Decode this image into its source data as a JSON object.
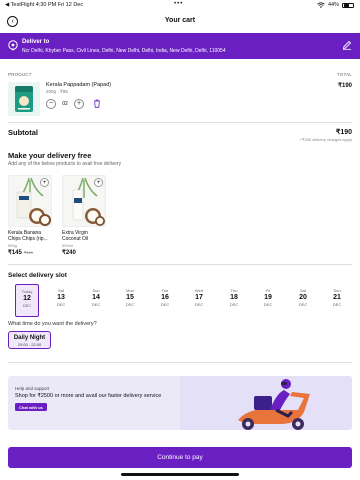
{
  "status_bar": {
    "left": "◀ TestFlight  4:30 PM  Fri 12 Dec",
    "center": "•••",
    "battery": "44%"
  },
  "header": {
    "title": "Your cart"
  },
  "delivery": {
    "label": "Deliver to",
    "address": "Ncr Delhi, Khyber Pass, Civil Lines, Delhi, New Delhi, Delhi, India, New Delhi, Delhi, 110054"
  },
  "cart": {
    "col_product": "PRODUCT",
    "col_total": "TOTAL",
    "item": {
      "name": "Kerala Pappadam (Papad)",
      "meta": "200g · ₹95",
      "quantity": "02",
      "total": "₹190"
    }
  },
  "subtotal": {
    "label": "Subtotal",
    "value": "₹190",
    "note": "+₹250 delivery charges apply"
  },
  "free_delivery": {
    "title": "Make your delivery free",
    "subtitle": "Add any of the below products to avail free delivery",
    "products": [
      {
        "name": "Kerala Banana Chips Chips (rip...",
        "meta": "500g",
        "price": "₹145",
        "mrp": "₹169"
      },
      {
        "name": "Extra Virgin Coconut Oil",
        "meta": "500ml",
        "price": "₹240",
        "mrp": ""
      }
    ]
  },
  "delivery_slot": {
    "title": "Select delivery slot",
    "dates": [
      {
        "weekday": "Today",
        "day": "12",
        "month": "DEC"
      },
      {
        "weekday": "Sat",
        "day": "13",
        "month": "DEC"
      },
      {
        "weekday": "Sun",
        "day": "14",
        "month": "DEC"
      },
      {
        "weekday": "Mon",
        "day": "15",
        "month": "DEC"
      },
      {
        "weekday": "Tue",
        "day": "16",
        "month": "DEC"
      },
      {
        "weekday": "Wed",
        "day": "17",
        "month": "DEC"
      },
      {
        "weekday": "Thu",
        "day": "18",
        "month": "DEC"
      },
      {
        "weekday": "Fri",
        "day": "19",
        "month": "DEC"
      },
      {
        "weekday": "Sat",
        "day": "20",
        "month": "DEC"
      },
      {
        "weekday": "Sun",
        "day": "21",
        "month": "DEC"
      }
    ],
    "time_question": "What time do you want the delivery?",
    "slot": {
      "name": "Daily Night",
      "time": "20:00 - 22:00"
    }
  },
  "help": {
    "title": "Help and support",
    "text": "Shop for ₹2500 or more and avail our faster delivery service",
    "button": "Chat with us"
  },
  "pay_button": "Continue to pay",
  "colors": {
    "accent": "#6a1fc2",
    "accent_light": "#f1e9fb",
    "banner_bg": "#ebe8f8",
    "scooter": "#e8743b"
  }
}
